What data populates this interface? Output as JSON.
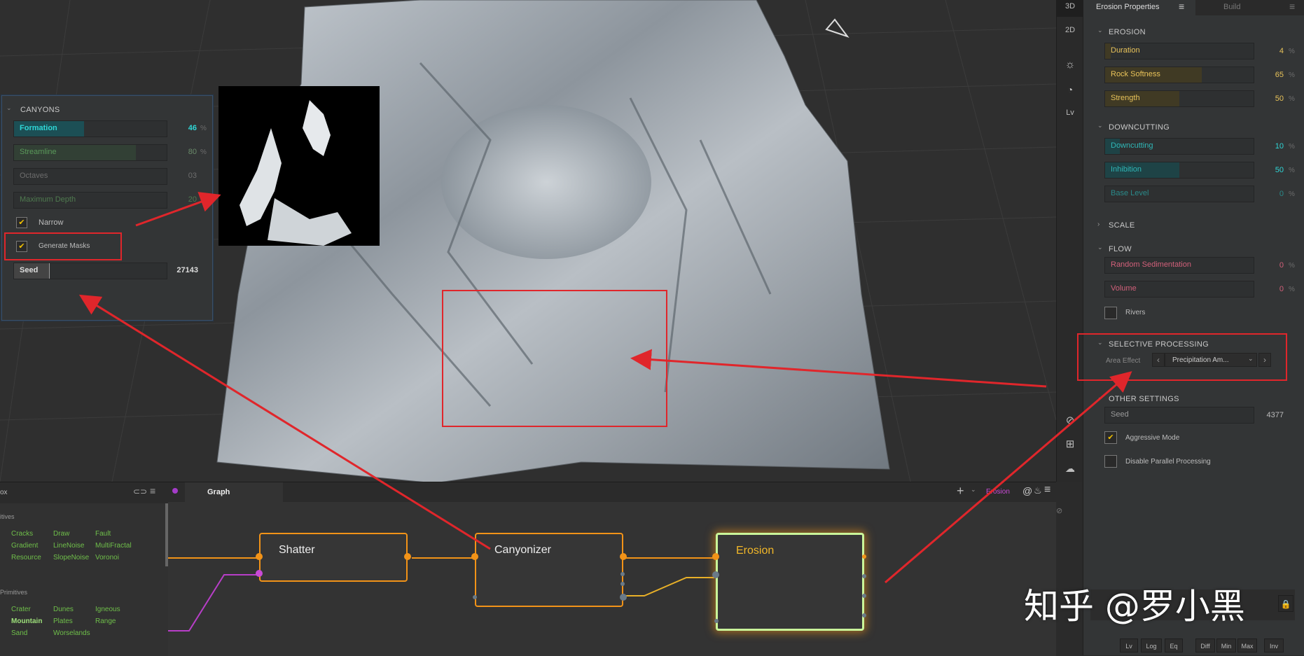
{
  "canyons": {
    "section_title": "CANYONS",
    "sliders": [
      {
        "label": "Formation",
        "value": "46",
        "unit": "%",
        "fill": 0.46
      },
      {
        "label": "Streamline",
        "value": "80",
        "unit": "%",
        "fill": 0.8
      },
      {
        "label": "Octaves",
        "value": "03",
        "unit": "",
        "fill": 0.0
      },
      {
        "label": "Maximum Depth",
        "value": "20",
        "unit": "%",
        "fill": 0.2
      }
    ],
    "narrow_label": "Narrow",
    "generate_masks_label": "Generate Masks",
    "seed_label": "Seed",
    "seed_value": "27143"
  },
  "viewport": {
    "view_3d": "3D",
    "view_2d": "2D",
    "level_label": "Lv"
  },
  "right_panel": {
    "tab_erosion": "Erosion Properties",
    "tab_build": "Build",
    "erosion": {
      "title": "EROSION",
      "sliders": [
        {
          "label": "Duration",
          "value": "4",
          "unit": "%",
          "fill": 0.04
        },
        {
          "label": "Rock Softness",
          "value": "65",
          "unit": "%",
          "fill": 0.65
        },
        {
          "label": "Strength",
          "value": "50",
          "unit": "%",
          "fill": 0.5
        }
      ]
    },
    "downcutting": {
      "title": "DOWNCUTTING",
      "sliders": [
        {
          "label": "Downcutting",
          "value": "10",
          "unit": "%",
          "fill": 0.1
        },
        {
          "label": "Inhibition",
          "value": "50",
          "unit": "%",
          "fill": 0.5
        },
        {
          "label": "Base Level",
          "value": "0",
          "unit": "%",
          "fill": 0.0
        }
      ]
    },
    "scale_title": "SCALE",
    "flow": {
      "title": "FLOW",
      "sliders": [
        {
          "label": "Random Sedimentation",
          "value": "0",
          "unit": "%",
          "fill": 0.0
        },
        {
          "label": "Volume",
          "value": "0",
          "unit": "%",
          "fill": 0.0
        }
      ],
      "rivers_label": "Rivers"
    },
    "selective": {
      "title": "SELECTIVE PROCESSING",
      "area_effect_label": "Area Effect",
      "area_effect_value": "Precipitation Am..."
    },
    "other": {
      "title": "OTHER SETTINGS",
      "seed_label": "Seed",
      "seed_value": "4377",
      "aggressive_label": "Aggressive Mode",
      "parallel_label": "Disable Parallel Processing"
    },
    "bottom_buttons": [
      "Lv",
      "Log",
      "Eq",
      "Diff",
      "Min",
      "Max",
      "Inv"
    ]
  },
  "graph": {
    "tab_label": "Graph",
    "active_node_label": "Erosion",
    "nodes": [
      {
        "title": "Shatter"
      },
      {
        "title": "Canyonizer"
      },
      {
        "title": "Erosion"
      }
    ]
  },
  "library": {
    "header": "ox",
    "group1_title": "itives",
    "group1_items": [
      "Cracks",
      "Draw",
      "Fault",
      "Gradient",
      "LineNoise",
      "MultiFractal",
      "Resource",
      "SlopeNoise",
      "Voronoi"
    ],
    "group2_title": "Primitives",
    "group2_items": [
      "Crater",
      "Dunes",
      "Igneous",
      "Mountain",
      "Plates",
      "Range",
      "Sand",
      "Worselands"
    ]
  },
  "watermark": "知乎 @罗小黑",
  "colors": {
    "accent_orange": "#f29318",
    "selected_green": "#c9f59a",
    "highlight_red": "#e0262b",
    "cyan_value": "#2fd6d6",
    "yellow_value": "#e8c35a",
    "flow_pink": "#d2607a"
  }
}
